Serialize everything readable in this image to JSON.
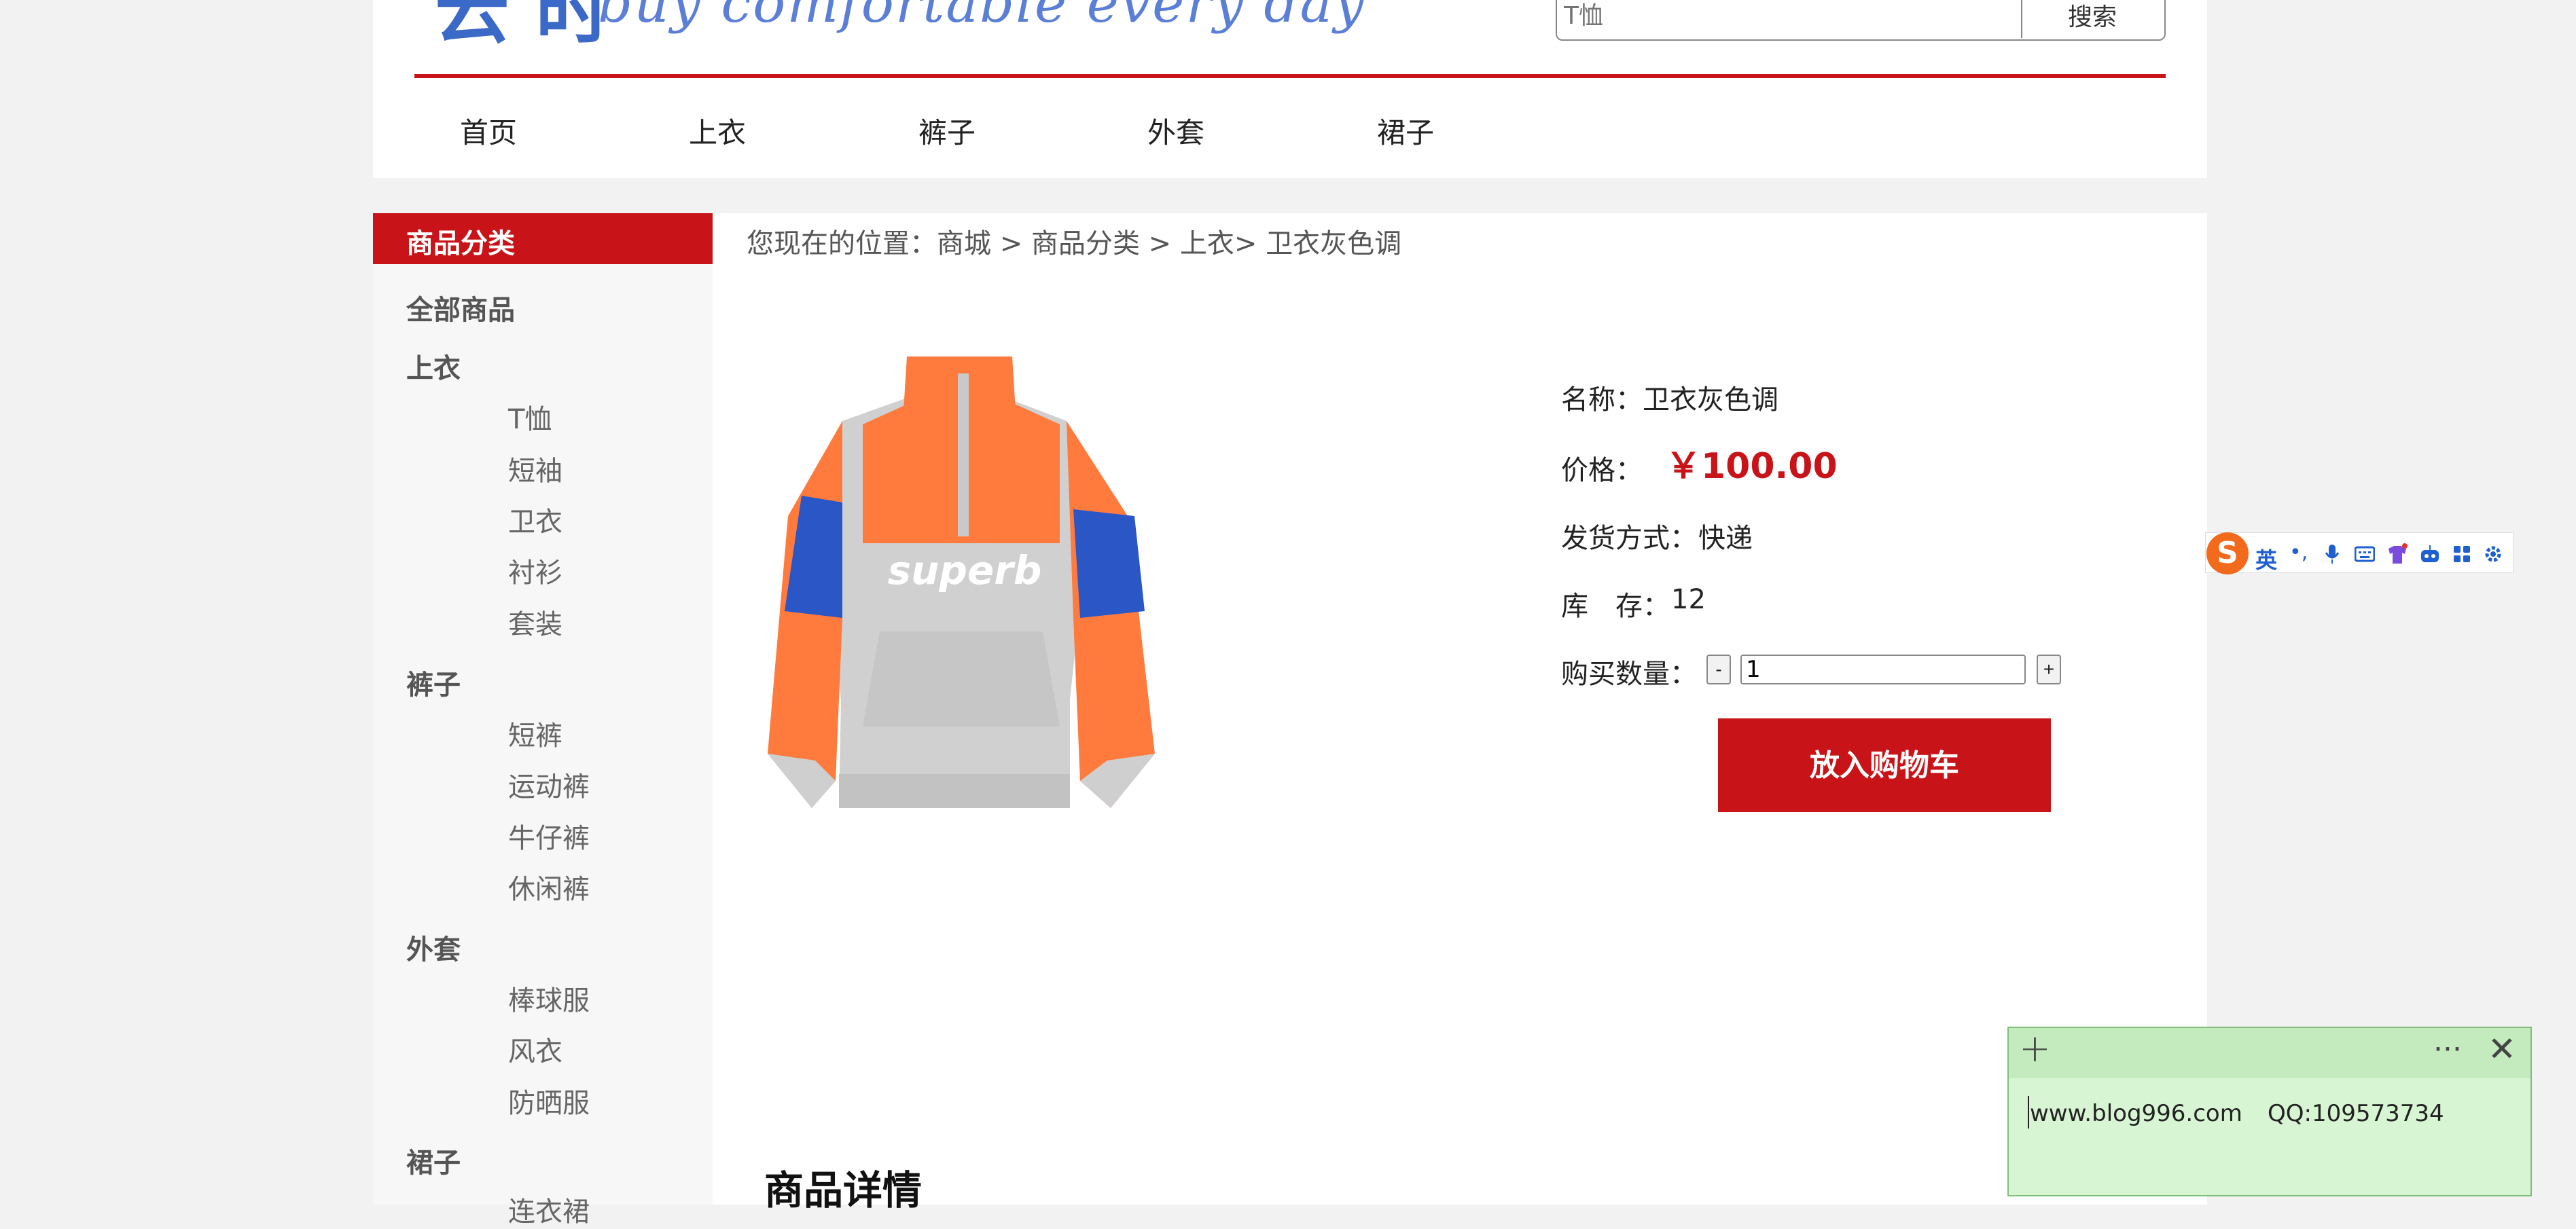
{
  "header": {
    "logo_mark": "云 时",
    "slogan": "buy comfortable every day",
    "search": {
      "placeholder": "T恤",
      "button_label": "搜索"
    },
    "nav": [
      "首页",
      "上衣",
      "裤子",
      "外套",
      "裙子"
    ]
  },
  "sidebar": {
    "heading": "商品分类",
    "all_label": "全部商品",
    "categories": [
      {
        "title": "上衣",
        "items": [
          "T恤",
          "短袖",
          "卫衣",
          "衬衫",
          "套装"
        ]
      },
      {
        "title": "裤子",
        "items": [
          "短裤",
          "运动裤",
          "牛仔裤",
          "休闲裤"
        ]
      },
      {
        "title": "外套",
        "items": [
          "棒球服",
          "风衣",
          "防晒服"
        ]
      },
      {
        "title": "裙子",
        "items": [
          "连衣裙"
        ]
      }
    ]
  },
  "breadcrumb": "您现在的位置：商城 > 商品分类 > 上衣> 卫衣灰色调",
  "product": {
    "image_logo_text": "superb",
    "name_label": "名称：",
    "name": "卫衣灰色调",
    "price_label": "价格：",
    "price": "￥100.00",
    "shipping_label": "发货方式：",
    "shipping": "快递",
    "stock_label": "库　存：",
    "stock": "12",
    "qty_label": "购买数量：",
    "qty_minus": "-",
    "qty_value": "1",
    "qty_plus": "+",
    "add_to_cart": "放入购物车",
    "details_heading": "商品详情"
  },
  "ime_toolbar": {
    "logo": "S",
    "lang": "英",
    "punct": "•,",
    "icons": [
      "mic-icon",
      "keyboard-icon",
      "skin-icon",
      "robot-icon",
      "apps-icon",
      "settings-icon"
    ]
  },
  "sticky_note": {
    "plus": "+",
    "more": "···",
    "close": "✕",
    "website": "www.blog996.com",
    "qq": "QQ:109573734"
  },
  "colors": {
    "accent_red": "#c81418",
    "note_green": "#d7f5d2",
    "ime_orange": "#f26a1b"
  }
}
